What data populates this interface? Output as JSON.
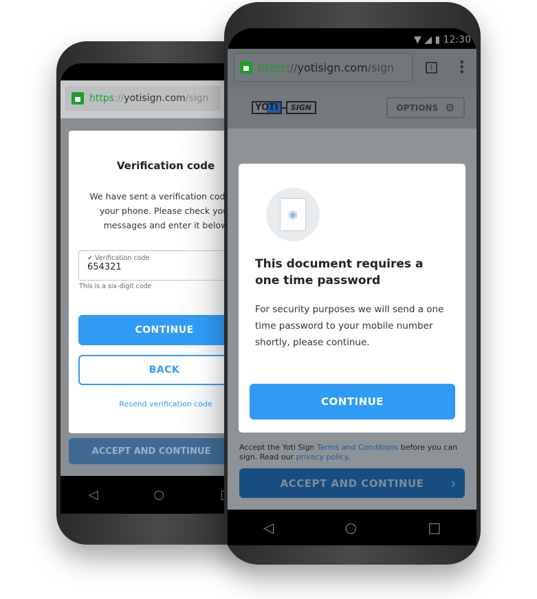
{
  "back_phone": {
    "url": {
      "scheme": "https",
      "sep": "://",
      "host": "yotisign.com",
      "path": "/sign"
    },
    "modal": {
      "title": "Verification code",
      "body_lines": [
        "We have sent a verification code to",
        "your phone. Please check your",
        "messages and enter it below"
      ],
      "field_label": "Verification code",
      "field_value": "654321",
      "hint": "This is a six-digit code",
      "continue": "CONTINUE",
      "back": "BACK",
      "resend": "Resend verification code"
    },
    "accept": "ACCEPT AND CONTINUE"
  },
  "front_phone": {
    "status": {
      "time": "12:30"
    },
    "url": {
      "scheme": "https",
      "sep": "://",
      "host": "yotisign.com",
      "path": "/sign"
    },
    "tabs_count": "1",
    "logo": {
      "left": "YOTI",
      "right": "SIGN"
    },
    "options": "OPTIONS",
    "modal": {
      "title": "This document requires a one time password",
      "body": "For security purposes we will send a one time password to your mobile number shortly, please continue.",
      "continue": "CONTINUE"
    },
    "terms": {
      "pre": "Accept the Yoti Sign ",
      "link1": "Terms and Conditions",
      "mid": " before you can sign. Read our ",
      "link2": "privacy policy",
      "post": "."
    },
    "accept": "ACCEPT AND CONTINUE"
  },
  "colors": {
    "accent": "#2f9bf5",
    "green": "#1f9b2a",
    "dark_accent": "#174d80"
  }
}
